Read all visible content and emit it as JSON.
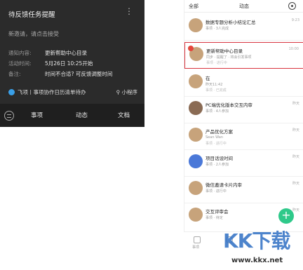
{
  "notification_card": {
    "title": "待反馈任务提醒",
    "more_icon": "more-vertical-icon",
    "subtitle": "新邀请，请点击接受",
    "rows": [
      {
        "label": "通知内容:",
        "value": "更新帮助中心目录"
      },
      {
        "label": "活动时间:",
        "value": "5月26日 10:25开始"
      },
      {
        "label": "备注:",
        "value": "时间不合适? 可反馈调整时间"
      }
    ],
    "footer": "飞项丨事项协作日历清单待办",
    "mini_program": "小程序"
  },
  "left_tabbar": {
    "items": [
      "事项",
      "动态",
      "文档"
    ]
  },
  "phone": {
    "top_all": "全部",
    "top_title": "动态",
    "list": [
      {
        "title": "数据专题分析小结论汇总",
        "sub": "事项 · 3人完成",
        "time": "9:23"
      },
      {
        "title": "更新帮助中心目录",
        "sub": "同步 · 提醒了 · 将会引发事项",
        "sub2": "事项 · 进行中",
        "time": "10:00"
      },
      {
        "title": "在",
        "sub": "昨天11:42",
        "sub2": "事项 · 已完成",
        "time": ""
      },
      {
        "title": "PC端优化版本交互内审",
        "sub": "事项 · 4人参加",
        "time": "昨天"
      },
      {
        "title": "产品优化方案",
        "sub": "Sean Wan",
        "sub2": "事项 · 进行中",
        "time": "昨天"
      },
      {
        "title": "项目话设时间",
        "sub": "事项 · 2人参加",
        "time": "昨天"
      },
      {
        "title": "微信邀请卡片内审",
        "sub": "事项 · 进行中",
        "time": "昨天"
      },
      {
        "title": "交互评审会",
        "sub": "事项 · 待定",
        "time": "昨天"
      }
    ],
    "fab": "+",
    "bottom_label": "事项"
  },
  "watermark": {
    "text": "KK下载",
    "url": "www.kkx.net"
  }
}
